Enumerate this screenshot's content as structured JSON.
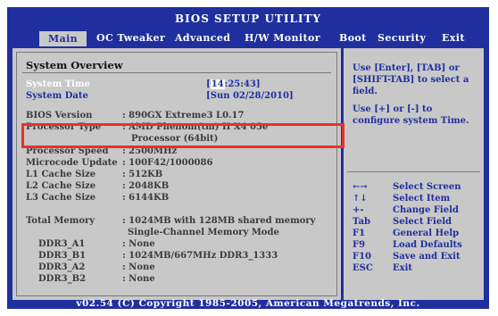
{
  "title": "BIOS SETUP UTILITY",
  "menu": [
    "Main",
    "OC Tweaker",
    "Advanced",
    "H/W Monitor",
    "Boot",
    "Security",
    "Exit"
  ],
  "section_title": "System Overview",
  "system_time": {
    "label": "System Time",
    "cursor": "14",
    "rest": ":25:43]",
    "prefix": "["
  },
  "system_date": {
    "label": "System Date",
    "value": "[Sun 02/28/2010]"
  },
  "info": [
    {
      "label": "BIOS Version",
      "value": ": 890GX Extreme3 L0.17"
    },
    {
      "label": "Processor Type",
      "value": ": AMD Phenom(tm) II X4 05e"
    },
    {
      "label": "",
      "value": "Processor (64bit)"
    },
    {
      "label": "Processor Speed",
      "value": ": 2500MHz"
    },
    {
      "label": "Microcode Update",
      "value": ": 100F42/1000086"
    },
    {
      "label": "L1 Cache Size",
      "value": ": 512KB"
    },
    {
      "label": "L2 Cache Size",
      "value": ": 2048KB"
    },
    {
      "label": "L3 Cache Size",
      "value": ": 6144KB"
    }
  ],
  "memory": [
    {
      "label": "Total Memory",
      "value": ": 1024MB with 128MB shared memory"
    },
    {
      "label": "",
      "value": "Single-Channel Memory Mode"
    },
    {
      "label": "DDR3_A1",
      "value": ": None"
    },
    {
      "label": "DDR3_B1",
      "value": ": 1024MB/667MHz DDR3_1333"
    },
    {
      "label": "DDR3_A2",
      "value": ": None"
    },
    {
      "label": "DDR3_B2",
      "value": ": None"
    }
  ],
  "help": {
    "top": "Use [Enter], [TAB] or [SHIFT-TAB] to select a field.",
    "bottom": "Use [+] or [-] to configure system Time."
  },
  "keys": [
    {
      "key": "←→",
      "desc": "Select Screen"
    },
    {
      "key": "↑↓",
      "desc": "Select Item"
    },
    {
      "key": "+-",
      "desc": "Change Field"
    },
    {
      "key": "Tab",
      "desc": "Select Field"
    },
    {
      "key": "F1",
      "desc": "General Help"
    },
    {
      "key": "F9",
      "desc": "Load Defaults"
    },
    {
      "key": "F10",
      "desc": "Save and Exit"
    },
    {
      "key": "ESC",
      "desc": "Exit"
    }
  ],
  "footer": "v02.54 (C) Copyright 1985-2005, American Megatrends, Inc.",
  "colors": {
    "bios_blue": "#1f2f9e",
    "panel_gray": "#c8c8c8",
    "highlight_red": "#e8312c"
  }
}
